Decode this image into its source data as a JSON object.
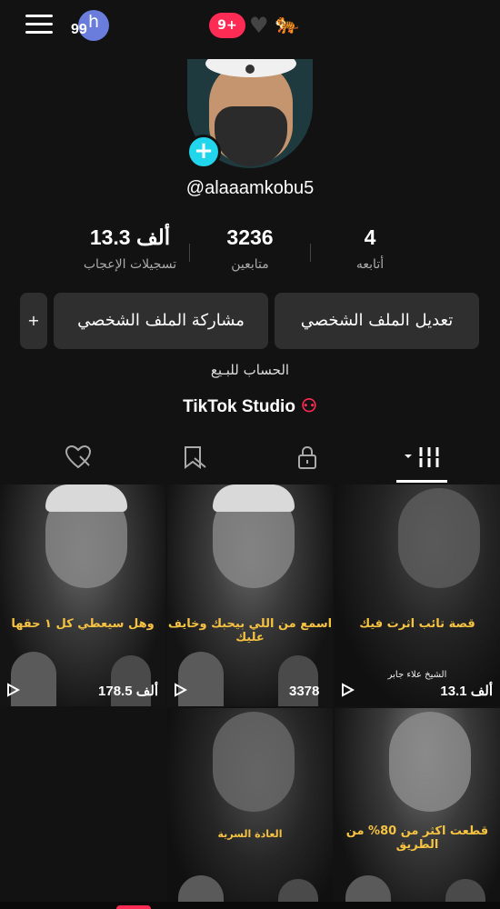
{
  "topbar": {
    "badge_number": "99",
    "badge_letter": "h",
    "notifications": "9+",
    "heart_icon": "heart-icon",
    "tiger_icon": "tiger-emoji"
  },
  "profile": {
    "username": "@alaaamkobu5",
    "add_icon": "+"
  },
  "stats": [
    {
      "value": "4",
      "label": "أتابعه"
    },
    {
      "value": "3236",
      "label": "متابعين"
    },
    {
      "value": "13.3 ألف",
      "label": "تسجيلات الإعجاب"
    }
  ],
  "buttons": {
    "edit_profile": "تعديل الملف الشخصي",
    "share_profile": "مشاركة الملف الشخصي",
    "add": "+"
  },
  "bio": "الحساب للبـيع",
  "studio": {
    "label": "TikTok Studio",
    "icon": "person-star-icon"
  },
  "tabs": [
    {
      "name": "videos-tab",
      "icon": "grid-icon"
    },
    {
      "name": "private-tab",
      "icon": "lock-icon"
    },
    {
      "name": "reposts-tab",
      "icon": "tag-icon"
    },
    {
      "name": "liked-tab",
      "icon": "heart-hidden-icon"
    }
  ],
  "videos": [
    {
      "caption": "وهل سيعطي كل ١ حقها",
      "views": "178.5 ألف",
      "sub": ""
    },
    {
      "caption": "اسمع من اللي بيحبك وخايف عليك",
      "views": "3378",
      "sub": ""
    },
    {
      "caption": "قصة تائب اثرت فيك",
      "views": "13.1 ألف",
      "sub": "الشيخ علاء جابر"
    },
    {
      "caption": "العادة السرية",
      "views": "",
      "sub": ""
    },
    {
      "caption": "قطعت اكثر من 80% من الطريق",
      "views": "",
      "sub": ""
    }
  ],
  "colors": {
    "accent": "#fe2c55",
    "cyan": "#20d5ec",
    "background": "#121212",
    "button": "#2f2f2f",
    "caption_yellow": "#f5c242"
  }
}
